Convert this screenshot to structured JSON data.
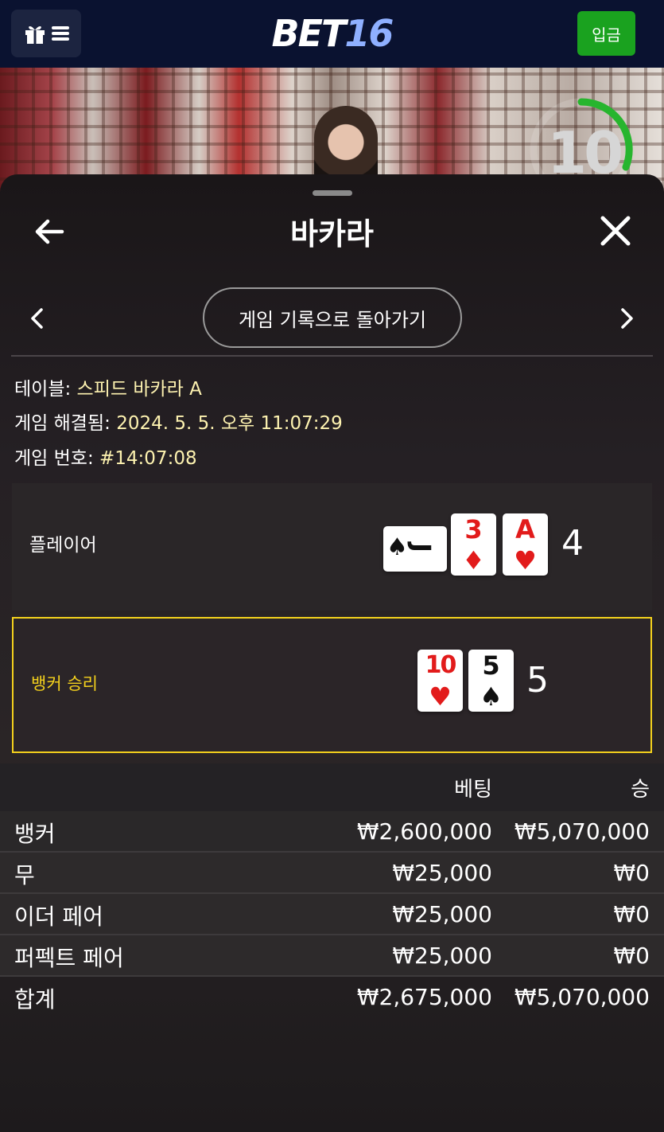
{
  "topbar": {
    "logo_part1": "BET",
    "logo_part2": "16",
    "deposit_label": "입금"
  },
  "video": {
    "timer_value": "10"
  },
  "sheet": {
    "title": "바카라",
    "back_to_history_label": "게임 기록으로 돌아가기"
  },
  "info": {
    "table_label": "테이블:",
    "table_value": "스피드 바카라 A",
    "resolved_label": "게임 해결됨:",
    "resolved_value": "2024. 5. 5. 오후 11:07:29",
    "game_no_label": "게임 번호:",
    "game_no_value": "#14:07:08"
  },
  "player": {
    "label": "플레이어",
    "score": "4",
    "cards": [
      {
        "rank": "J",
        "suit": "♠",
        "color": "#111111",
        "sideways": true
      },
      {
        "rank": "3",
        "suit": "♦",
        "color": "#e21b1b"
      },
      {
        "rank": "A",
        "suit": "♥",
        "color": "#e21b1b"
      }
    ]
  },
  "banker": {
    "label": "뱅커 승리",
    "score": "5",
    "cards": [
      {
        "rank": "10",
        "suit": "♥",
        "color": "#e21b1b"
      },
      {
        "rank": "5",
        "suit": "♠",
        "color": "#111111"
      }
    ],
    "highlight_color": "#f4d11d"
  },
  "bets": {
    "header_bet": "베팅",
    "header_win": "승",
    "rows": [
      {
        "name": "뱅커",
        "bet": "₩2,600,000",
        "win": "₩5,070,000"
      },
      {
        "name": "무",
        "bet": "₩25,000",
        "win": "₩0"
      },
      {
        "name": "이더 페어",
        "bet": "₩25,000",
        "win": "₩0"
      },
      {
        "name": "퍼펙트 페어",
        "bet": "₩25,000",
        "win": "₩0"
      }
    ],
    "total": {
      "name": "합계",
      "bet": "₩2,675,000",
      "win": "₩5,070,000"
    }
  },
  "colors": {
    "deposit_green": "#1aa21f",
    "topbar_navy": "#0a1230",
    "info_value": "#fdf2b0",
    "timer_green": "#27b52e"
  }
}
